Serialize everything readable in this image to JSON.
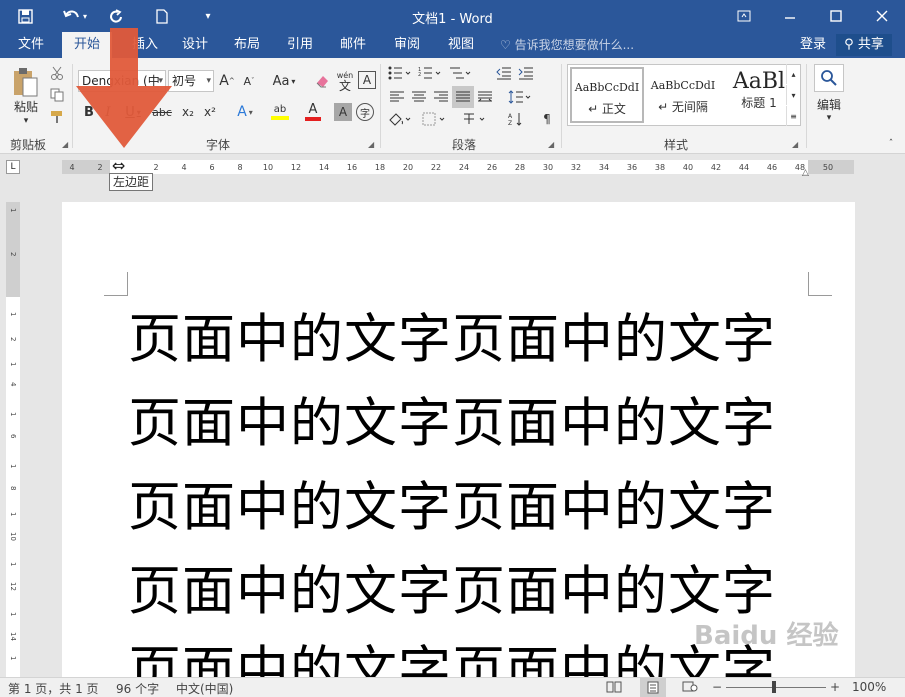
{
  "window": {
    "title": "文档1 - Word",
    "qat": {
      "save": "save-icon",
      "undo": "undo-icon",
      "redo": "redo-icon",
      "new": "new-doc-icon",
      "customize": "customize-icon"
    }
  },
  "tabs": [
    "文件",
    "开始",
    "插入",
    "设计",
    "布局",
    "引用",
    "邮件",
    "审阅",
    "视图"
  ],
  "active_tab": "开始",
  "tell_me": "告诉我您想要做什么...",
  "account": {
    "login": "登录",
    "share": "共享"
  },
  "clipboard": {
    "paste": "粘贴",
    "label": "剪贴板"
  },
  "font": {
    "name": "Dengxian (中",
    "size": "初号",
    "label": "字体",
    "grow": "A",
    "shrink": "A",
    "case": "Aa",
    "phonetic": "wén",
    "phonetic_char": "文",
    "border_char": "A",
    "bold": "B",
    "italic": "I",
    "underline": "U",
    "strike": "abc",
    "sub": "x₂",
    "super": "x²",
    "effects": "A",
    "highlight": "ab",
    "color": "A",
    "shading": "A",
    "enclose": "字"
  },
  "paragraph": {
    "label": "段落"
  },
  "styles": {
    "label": "样式",
    "items": [
      {
        "preview": "AaBbCcDdI",
        "name": "↵ 正文"
      },
      {
        "preview": "AaBbCcDdI",
        "name": "↵ 无间隔"
      },
      {
        "preview": "AaBl",
        "name": "标题 1"
      }
    ]
  },
  "editing": {
    "label": "编辑"
  },
  "ruler": {
    "ticks": [
      "4",
      "2",
      "2",
      "4",
      "6",
      "8",
      "10",
      "12",
      "14",
      "16",
      "18",
      "20",
      "22",
      "24",
      "26",
      "28",
      "30",
      "32",
      "34",
      "36",
      "38",
      "40",
      "42",
      "44",
      "46",
      "48",
      "50"
    ],
    "vticks": [
      "1",
      "2",
      "1",
      "2",
      "1",
      "4",
      "1",
      "6",
      "1",
      "8",
      "1",
      "10",
      "1",
      "12",
      "1",
      "14",
      "1",
      "16",
      "1",
      "18"
    ],
    "tab_selector": "L",
    "tooltip": "左边距"
  },
  "document": {
    "lines": [
      "页面中的文字页面中的文字",
      "页面中的文字页面中的文字",
      "页面中的文字页面中的文字",
      "页面中的文字页面中的文字",
      "页面中的文字页面中的文字"
    ]
  },
  "status": {
    "page": "第 1 页，共 1 页",
    "words": "96 个字",
    "lang": "中文(中国)",
    "zoom": "100%"
  },
  "watermark": "Baidu 经验",
  "colors": {
    "brand": "#2b579a",
    "arrow": "#e05a3a"
  }
}
